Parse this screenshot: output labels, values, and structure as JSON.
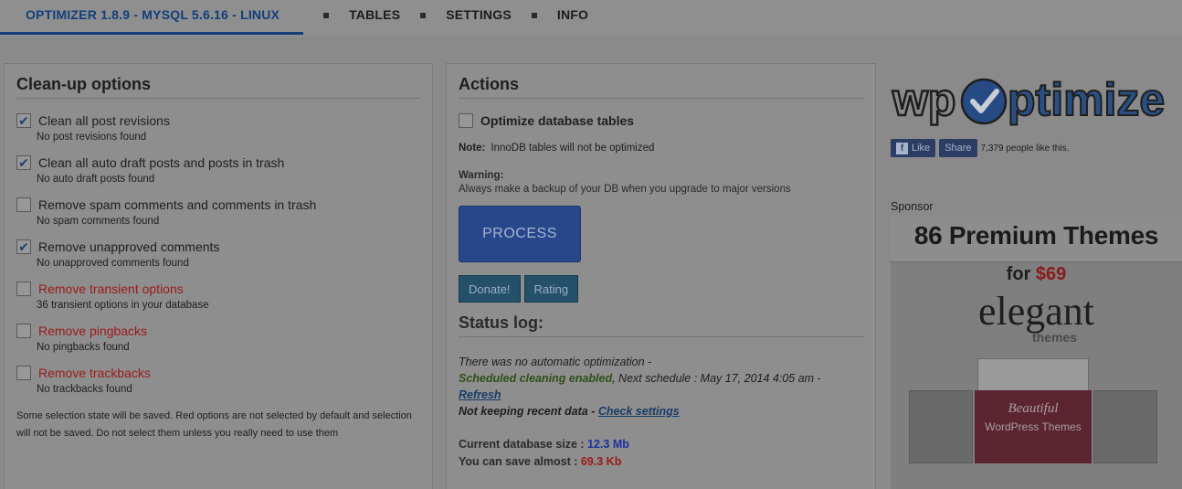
{
  "nav": {
    "active": "OPTIMIZER 1.8.9 - MYSQL 5.6.16 - LINUX",
    "items": [
      "TABLES",
      "SETTINGS",
      "INFO"
    ]
  },
  "cleanup": {
    "title": "Clean-up options",
    "options": [
      {
        "label": "Clean all post revisions",
        "sub": "No post revisions found",
        "checked": true,
        "red": false
      },
      {
        "label": "Clean all auto draft posts and posts in trash",
        "sub": "No auto draft posts found",
        "checked": true,
        "red": false
      },
      {
        "label": "Remove spam comments and comments in trash",
        "sub": "No spam comments found",
        "checked": false,
        "red": false
      },
      {
        "label": "Remove unapproved comments",
        "sub": "No unapproved comments found",
        "checked": true,
        "red": false
      },
      {
        "label": "Remove transient options",
        "sub": "36 transient options in your database",
        "checked": false,
        "red": true
      },
      {
        "label": "Remove pingbacks",
        "sub": "No pingbacks found",
        "checked": false,
        "red": true
      },
      {
        "label": "Remove trackbacks",
        "sub": "No trackbacks found",
        "checked": false,
        "red": true
      }
    ],
    "footnote": "Some selection state will be saved. Red options are not selected by default and selection will not be saved. Do not select them unless you really need to use them"
  },
  "actions": {
    "title": "Actions",
    "optimize_label": "Optimize database tables",
    "note_label": "Note:",
    "note_text": "InnoDB tables will not be optimized",
    "warning_label": "Warning:",
    "warning_text": "Always make a backup of your DB when you upgrade to major versions",
    "process": "PROCESS",
    "donate": "Donate!",
    "rating": "Rating"
  },
  "status": {
    "title": "Status log:",
    "line1": "There was no automatic optimization -",
    "line2_green": "Scheduled cleaning enabled,",
    "line2_rest": " Next schedule : May 17, 2014 4:05 am -",
    "refresh": "Refresh",
    "line4": "Not keeping recent data - ",
    "check_settings": "Check settings",
    "db_size_label": "Current database size : ",
    "db_size_value": "12.3 Mb",
    "save_label": "You can save almost : ",
    "save_value": "69.3 Kb"
  },
  "sidebar": {
    "logo_wp": "wp",
    "logo_rest": "ptimize",
    "like": "Like",
    "share": "Share",
    "likes_text": "7,379 people like this.",
    "sponsor": "Sponsor",
    "ad_title": "86 Premium Themes",
    "ad_for": "for ",
    "ad_price": "$69",
    "ad_brand": "elegant",
    "ad_brand_sub": "themes",
    "ad_banner1": "Beautiful",
    "ad_banner2": "WordPress Themes"
  }
}
